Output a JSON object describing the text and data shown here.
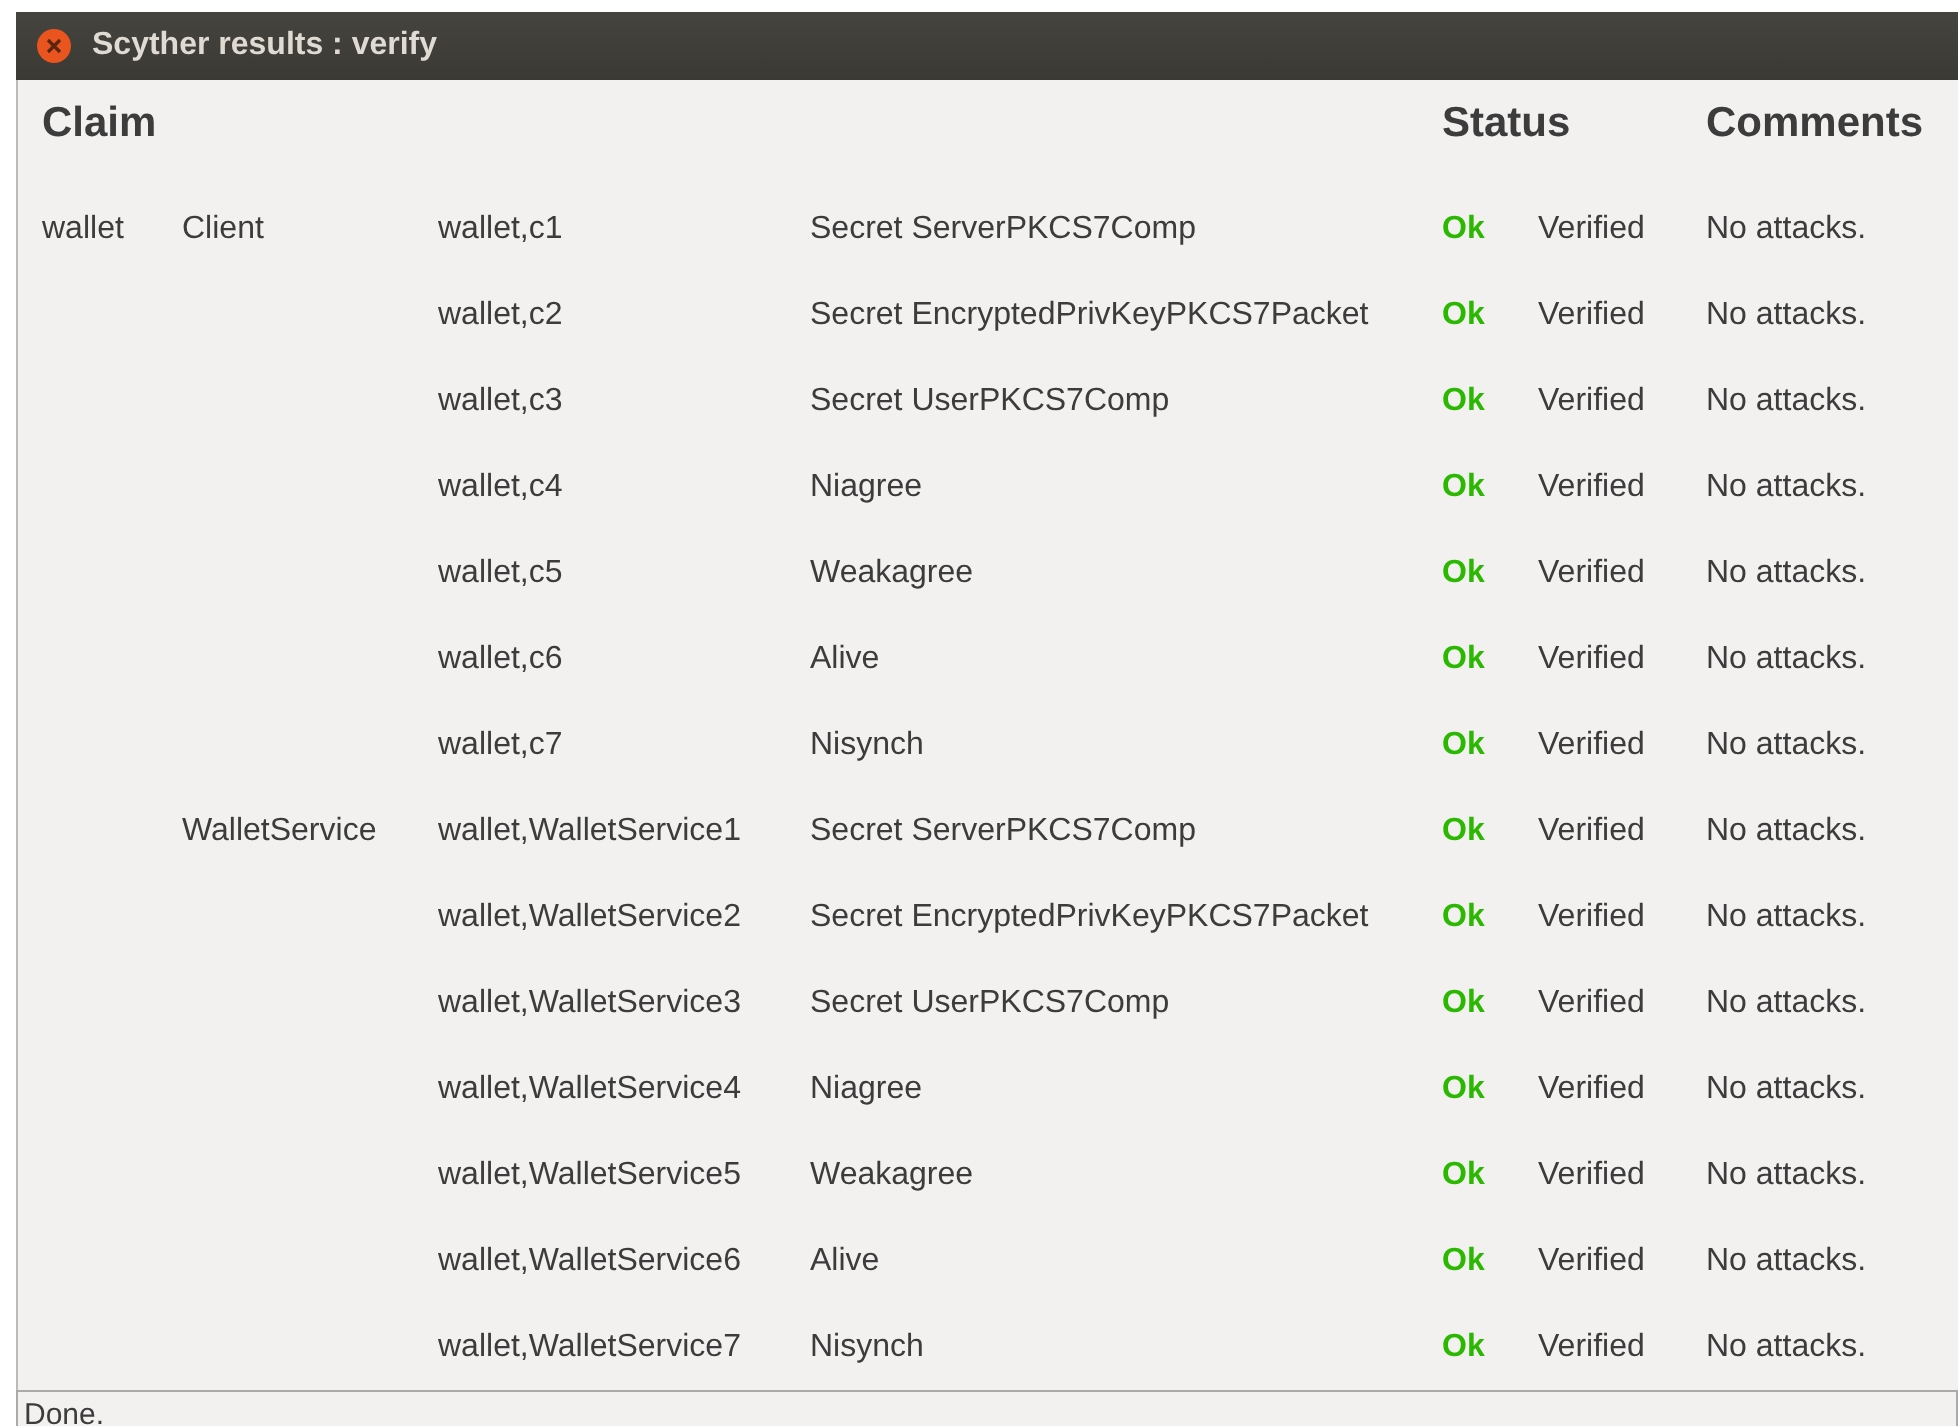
{
  "window": {
    "title": "Scyther results : verify"
  },
  "columns": {
    "claim": "Claim",
    "status": "Status",
    "comments": "Comments"
  },
  "protocols": [
    {
      "name": "wallet",
      "roles": [
        {
          "name": "Client",
          "claims": [
            {
              "id": "wallet,c1",
              "claim": "Secret ServerPKCS7Comp",
              "status": "Ok",
              "verdict": "Verified",
              "comment": "No attacks."
            },
            {
              "id": "wallet,c2",
              "claim": "Secret EncryptedPrivKeyPKCS7Packet",
              "status": "Ok",
              "verdict": "Verified",
              "comment": "No attacks."
            },
            {
              "id": "wallet,c3",
              "claim": "Secret UserPKCS7Comp",
              "status": "Ok",
              "verdict": "Verified",
              "comment": "No attacks."
            },
            {
              "id": "wallet,c4",
              "claim": "Niagree",
              "status": "Ok",
              "verdict": "Verified",
              "comment": "No attacks."
            },
            {
              "id": "wallet,c5",
              "claim": "Weakagree",
              "status": "Ok",
              "verdict": "Verified",
              "comment": "No attacks."
            },
            {
              "id": "wallet,c6",
              "claim": "Alive",
              "status": "Ok",
              "verdict": "Verified",
              "comment": "No attacks."
            },
            {
              "id": "wallet,c7",
              "claim": "Nisynch",
              "status": "Ok",
              "verdict": "Verified",
              "comment": "No attacks."
            }
          ]
        },
        {
          "name": "WalletService",
          "claims": [
            {
              "id": "wallet,WalletService1",
              "claim": "Secret ServerPKCS7Comp",
              "status": "Ok",
              "verdict": "Verified",
              "comment": "No attacks."
            },
            {
              "id": "wallet,WalletService2",
              "claim": "Secret EncryptedPrivKeyPKCS7Packet",
              "status": "Ok",
              "verdict": "Verified",
              "comment": "No attacks."
            },
            {
              "id": "wallet,WalletService3",
              "claim": "Secret UserPKCS7Comp",
              "status": "Ok",
              "verdict": "Verified",
              "comment": "No attacks."
            },
            {
              "id": "wallet,WalletService4",
              "claim": "Niagree",
              "status": "Ok",
              "verdict": "Verified",
              "comment": "No attacks."
            },
            {
              "id": "wallet,WalletService5",
              "claim": "Weakagree",
              "status": "Ok",
              "verdict": "Verified",
              "comment": "No attacks."
            },
            {
              "id": "wallet,WalletService6",
              "claim": "Alive",
              "status": "Ok",
              "verdict": "Verified",
              "comment": "No attacks."
            },
            {
              "id": "wallet,WalletService7",
              "claim": "Nisynch",
              "status": "Ok",
              "verdict": "Verified",
              "comment": "No attacks."
            }
          ]
        }
      ]
    }
  ],
  "status_bar": "Done."
}
